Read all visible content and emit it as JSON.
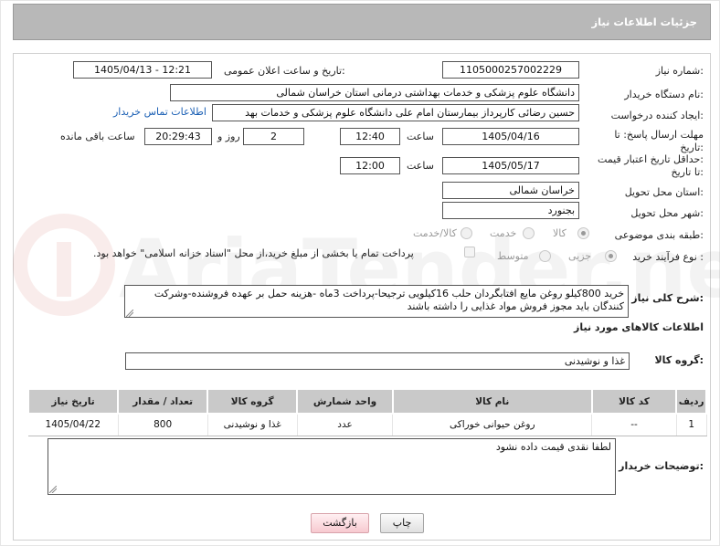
{
  "header": {
    "title": "جزئیات اطلاعات نیاز"
  },
  "fields": {
    "need_number_label": "شماره نیاز:",
    "need_number": "1105000257002229",
    "announce_label": "تاریخ و ساعت اعلان عمومی:",
    "announce_value": "1405/04/13 - 12:21",
    "buyer_org_label": "نام دستگاه خریدار:",
    "buyer_org": "دانشگاه علوم پزشکی و خدمات بهداشتی درمانی استان خراسان شمالی",
    "requester_label": "ایجاد کننده درخواست:",
    "requester": "حسین رضائی کارپرداز بیمارستان امام علی دانشگاه علوم پزشکی و خدمات بهد",
    "contact_link": "اطلاعات تماس خریدار",
    "deadline_label_1": "مهلت ارسال پاسخ: تا",
    "deadline_label_2": "تاریخ:",
    "deadline_date": "1405/04/16",
    "hour_label": "ساعت",
    "deadline_time": "12:40",
    "days": "2",
    "day_label": "روز و",
    "remaining_time": "20:29:43",
    "remaining_label": "ساعت باقی مانده",
    "min_validity_label_1": "حداقل تاریخ اعتبار قیمت:",
    "min_validity_label_2": "تا تاریخ:",
    "validity_date": "1405/05/17",
    "validity_time": "12:00",
    "province_label": "استان محل تحویل:",
    "province": "خراسان شمالی",
    "city_label": "شهر محل تحویل:",
    "city": "بجنورد",
    "category_label": "طبقه بندی موضوعی:",
    "category_options": [
      "کالا",
      "خدمت",
      "کالا/خدمت"
    ],
    "category_selected": "کالا",
    "process_label": "نوع فرآیند خرید :",
    "process_options": [
      "جزیی",
      "متوسط"
    ],
    "process_selected": "جزیی",
    "payment_note": "پرداخت تمام یا بخشی از مبلغ خرید،از محل \"اسناد خزانه اسلامی\" خواهد بود."
  },
  "description": {
    "label": "شرح کلی نیاز:",
    "text": "خرید 800کیلو روغن مایع افتابگردان حلب 16کیلویی ترجیحا-پرداخت 3ماه -هزینه حمل بر عهده فروشنده-وشرکت کنندگان باید مجوز فروش مواد غذایی را داشته باشند"
  },
  "goods": {
    "section_title": "اطلاعات کالاهای مورد نیاز",
    "group_label": "گروه کالا:",
    "group_value": "غذا و نوشیدنی",
    "columns": [
      "ردیف",
      "کد کالا",
      "نام کالا",
      "واحد شمارش",
      "گروه کالا",
      "تعداد / مقدار",
      "تاریخ نیاز"
    ],
    "rows": [
      {
        "row": "1",
        "code": "--",
        "name": "روغن حیوانی خوراکی",
        "unit": "عدد",
        "group": "غذا و نوشیدنی",
        "qty": "800",
        "date": "1405/04/22"
      }
    ]
  },
  "buyer_notes": {
    "label": "توضیحات خریدار:",
    "text": "لطفا نقدی قیمت داده نشود"
  },
  "buttons": {
    "print": "چاپ",
    "back": "بازگشت"
  },
  "watermark": {
    "text": "AriaTender.net"
  },
  "colors": {
    "title_bg": "#b8b8b8",
    "table_header_bg": "#c9c9c9",
    "link": "#1a5fb4",
    "back_button": "#f7c9d0"
  }
}
